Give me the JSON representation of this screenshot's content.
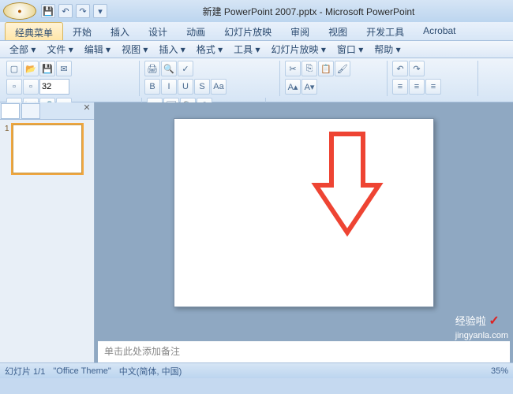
{
  "titlebar": {
    "title": "新建 PowerPoint 2007.pptx - Microsoft PowerPoint",
    "qat": {
      "save": "💾",
      "undo": "↶",
      "redo": "↷"
    }
  },
  "tabs": {
    "classic": "经典菜单",
    "home": "开始",
    "insert": "插入",
    "design": "设计",
    "anim": "动画",
    "slideshow": "幻灯片放映",
    "review": "审阅",
    "view": "视图",
    "dev": "开发工具",
    "acrobat": "Acrobat"
  },
  "menubar": {
    "all": "全部 ▾",
    "file": "文件 ▾",
    "edit": "编辑 ▾",
    "view": "视图 ▾",
    "insert": "插入 ▾",
    "format": "格式 ▾",
    "tools": "工具 ▾",
    "slideshow": "幻灯片放映 ▾",
    "window": "窗口 ▾",
    "help": "帮助 ▾"
  },
  "toolbar": {
    "font_size": "32",
    "bold": "B",
    "italic": "I",
    "underline": "U",
    "strike": "S",
    "shadow": "Aa"
  },
  "panel": {
    "close": "✕",
    "slide_num": "1"
  },
  "notes": {
    "placeholder": "单击此处添加备注"
  },
  "statusbar": {
    "slide": "幻灯片 1/1",
    "theme": "\"Office Theme\"",
    "lang": "中文(简体, 中国)",
    "zoom": "35%"
  },
  "watermark": {
    "text1": "经验啦",
    "text2": "jingyanla.com"
  }
}
